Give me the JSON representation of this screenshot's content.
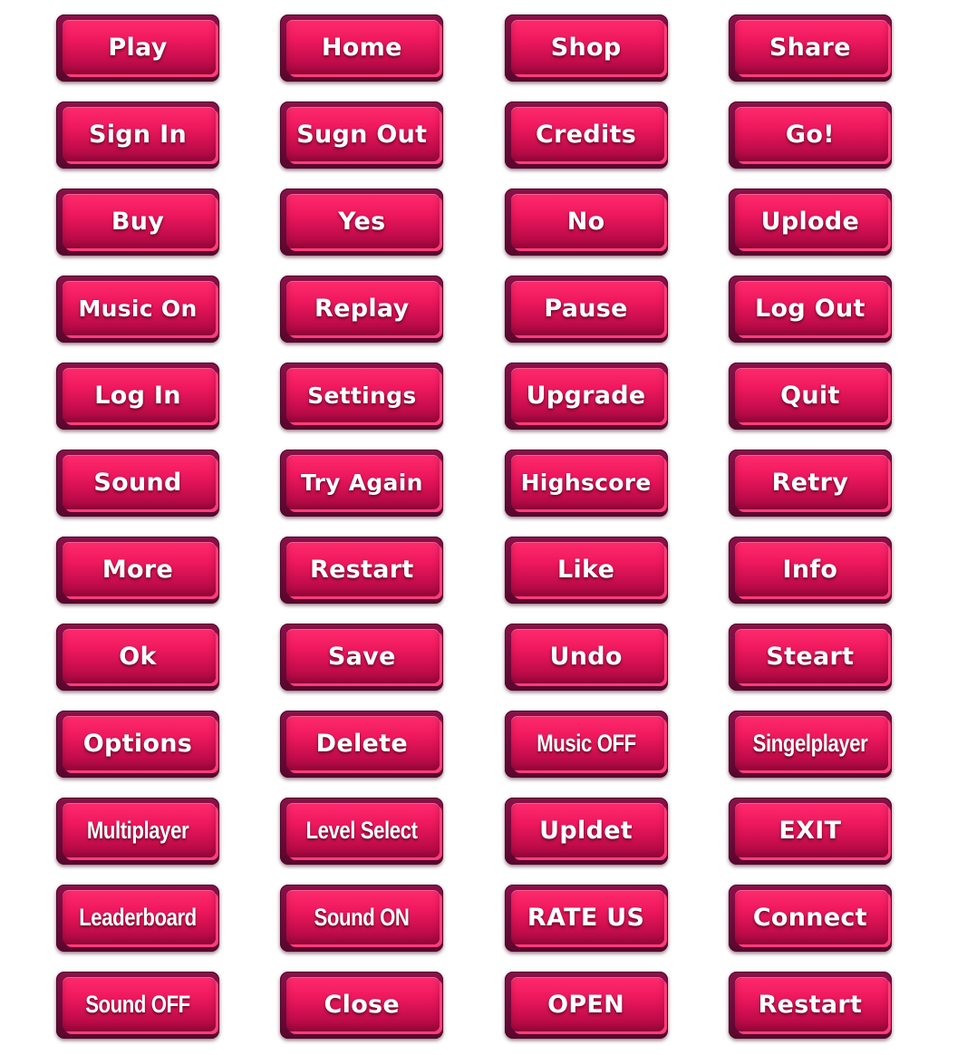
{
  "buttons": [
    {
      "label": "Play"
    },
    {
      "label": "Home"
    },
    {
      "label": "Shop"
    },
    {
      "label": "Share"
    },
    {
      "label": "Sign In"
    },
    {
      "label": "Sugn Out"
    },
    {
      "label": "Credits"
    },
    {
      "label": "Go!"
    },
    {
      "label": "Buy"
    },
    {
      "label": "Yes"
    },
    {
      "label": "No"
    },
    {
      "label": "Uplode"
    },
    {
      "label": "Music On"
    },
    {
      "label": "Replay"
    },
    {
      "label": "Pause"
    },
    {
      "label": "Log Out"
    },
    {
      "label": "Log In"
    },
    {
      "label": "Settings"
    },
    {
      "label": "Upgrade"
    },
    {
      "label": "Quit"
    },
    {
      "label": "Sound"
    },
    {
      "label": "Try Again"
    },
    {
      "label": "Highscore"
    },
    {
      "label": "Retry"
    },
    {
      "label": "More"
    },
    {
      "label": "Restart"
    },
    {
      "label": "Like"
    },
    {
      "label": "Info"
    },
    {
      "label": "Ok"
    },
    {
      "label": "Save"
    },
    {
      "label": "Undo"
    },
    {
      "label": "Steart"
    },
    {
      "label": "Options"
    },
    {
      "label": "Delete"
    },
    {
      "label": "Music OFF"
    },
    {
      "label": "Singelplayer"
    },
    {
      "label": "Multiplayer"
    },
    {
      "label": "Level Select"
    },
    {
      "label": "Upldet"
    },
    {
      "label": "EXIT"
    },
    {
      "label": "Leaderboard"
    },
    {
      "label": "Sound ON"
    },
    {
      "label": "RATE US"
    },
    {
      "label": "Connect"
    },
    {
      "label": "Sound OFF"
    },
    {
      "label": "Close"
    },
    {
      "label": "OPEN"
    },
    {
      "label": "Restart"
    }
  ],
  "colors": {
    "face_top": "#ff2b6e",
    "face_bottom": "#a60840",
    "base": "#6e0a3a",
    "text": "#ffffff"
  }
}
